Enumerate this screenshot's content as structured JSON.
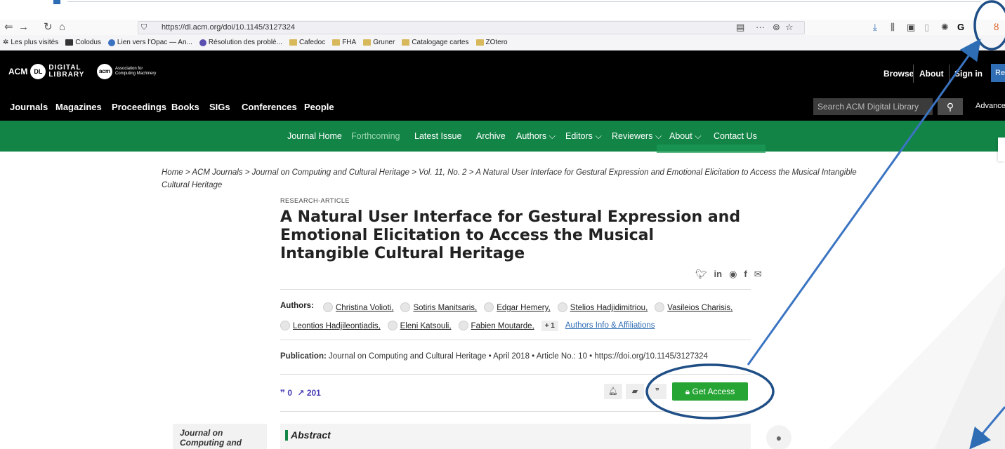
{
  "browser": {
    "url": "https://dl.acm.org/doi/10.1145/3127324",
    "bookmarks": [
      "Les plus visités",
      "Colodus",
      "Lien vers l'Opac — An...",
      "Résolution des problè...",
      "Cafedoc",
      "FHA",
      "Gruner",
      "Catalogage cartes",
      "ZOtero"
    ]
  },
  "acm_header": {
    "logo_text": "ACM",
    "logo_sub": "DIGITAL\nLIBRARY",
    "assoc_text": "Association for Computing Machinery",
    "browse": "Browse",
    "about": "About",
    "sign_in": "Sign in",
    "register": "Re"
  },
  "main_nav": {
    "items": [
      "Journals",
      "Magazines",
      "Proceedings",
      "Books",
      "SIGs",
      "Conferences",
      "People"
    ],
    "search_placeholder": "Search ACM Digital Library",
    "advanced": "Advanced"
  },
  "journal_nav": {
    "items": [
      "Journal Home",
      "Forthcoming",
      "Latest Issue",
      "Archive",
      "Authors ⌵",
      "Editors ⌵",
      "Reviewers ⌵",
      "About ⌵",
      "Contact Us"
    ]
  },
  "breadcrumb": "Home > ACM Journals > Journal on Computing and Cultural Heritage  > Vol. 11, No. 2 > A Natural User Interface for Gestural Expression and Emotional Elicitation to Access the Musical Intangible Cultural Heritage",
  "article": {
    "type": "RESEARCH-ARTICLE",
    "title": "A Natural User Interface for Gestural Expression and Emotional Elicitation to Access the Musical Intangible Cultural Heritage",
    "authors_label": "Authors:",
    "authors": [
      "Christina Volioti,",
      "Sotiris Manitsaris,",
      "Edgar Hemery,",
      "Stelios Hadjidimitriou,",
      "Vasileios Charisis,",
      "Leontios Hadjileontiadis,",
      "Eleni Katsouli,",
      "Fabien Moutarde,"
    ],
    "more_authors": "+ 1",
    "affiliations_link": "Authors Info & Affiliations",
    "publication_label": "Publication:",
    "publication_text": "Journal on Computing and Cultural Heritage  • April 2018  • Article No.: 10  • https://doi.org/10.1145/3127324",
    "citations": "0",
    "downloads": "201",
    "get_access": "Get Access"
  },
  "sidebar": {
    "journal_name": "Journal on Computing and Cultural Heritage"
  },
  "abstract": {
    "title": "Abstract"
  },
  "colors": {
    "acm_green": "#128446",
    "access_green": "#26a534",
    "annotation_blue": "#2e6db4"
  }
}
